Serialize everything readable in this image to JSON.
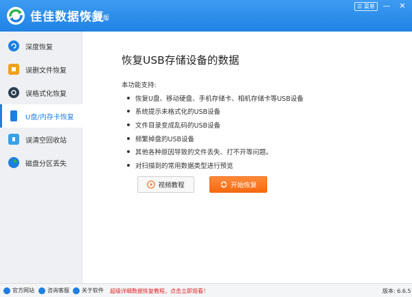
{
  "app": {
    "title": "佳佳数据恢复",
    "edition": "专业版",
    "menu_label": "☰ 菜单",
    "minimize_glyph": "—",
    "close_glyph": "✕"
  },
  "sidebar": {
    "items": [
      {
        "label": "深度恢复",
        "icon": "deep-recovery-icon",
        "active": false
      },
      {
        "label": "误删文件恢复",
        "icon": "deleted-file-icon",
        "active": false
      },
      {
        "label": "误格式化恢复",
        "icon": "format-recovery-icon",
        "active": false
      },
      {
        "label": "U盘/内存卡恢复",
        "icon": "usb-drive-icon",
        "active": true
      },
      {
        "label": "误清空回收站",
        "icon": "recycle-bin-icon",
        "active": false
      },
      {
        "label": "磁盘分区丢失",
        "icon": "partition-icon",
        "active": false
      }
    ]
  },
  "main": {
    "heading": "恢复USB存储设备的数据",
    "intro": "本功能支持:",
    "features": [
      "恢复U盘、移动硬盘、手机存储卡、相机存储卡等USB设备",
      "系统提示未格式化的USB设备",
      "文件目录变成乱码的USB设备",
      "频繁掉盘的USB设备",
      "其他各种原因导致的文件丢失、打不开等问题。",
      "对扫描到的常用数据类型进行预览"
    ],
    "video_button": "视频教程",
    "start_button": "开始恢复"
  },
  "status": {
    "website": "官方网站",
    "support": "咨询客服",
    "about": "关于软件",
    "promo": "超级详细数据恢复教程，点击立即观看！",
    "version": "版本: 6.6.5"
  },
  "colors": {
    "accent": "#1f7fe0",
    "titlebar": "#2a8de9",
    "start_button": "#f66a10",
    "promo_text": "#e02020"
  }
}
